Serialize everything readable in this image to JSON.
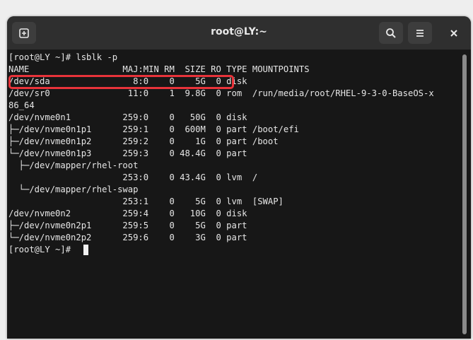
{
  "window": {
    "title": "root@LY:~"
  },
  "icons": {
    "new_tab": "new-tab-icon",
    "search": "search-icon",
    "menu": "hamburger-menu-icon",
    "close": "close-icon"
  },
  "colors": {
    "terminal_bg": "#171717",
    "titlebar_bg": "#2f2f2f",
    "text": "#e6e6e6",
    "highlight": "#e8333a"
  },
  "terminal": {
    "lines": [
      "[root@LY ~]# lsblk -p",
      "NAME                  MAJ:MIN RM  SIZE RO TYPE MOUNTPOINTS",
      "/dev/sda                8:0    0    5G  0 disk",
      "/dev/sr0               11:0    1  9.8G  0 rom  /run/media/root/RHEL-9-3-0-BaseOS-x",
      "86_64",
      "/dev/nvme0n1          259:0    0   50G  0 disk",
      "├─/dev/nvme0n1p1      259:1    0  600M  0 part /boot/efi",
      "├─/dev/nvme0n1p2      259:2    0    1G  0 part /boot",
      "└─/dev/nvme0n1p3      259:3    0 48.4G  0 part",
      "  ├─/dev/mapper/rhel-root",
      "                      253:0    0 43.4G  0 lvm  /",
      "  └─/dev/mapper/rhel-swap",
      "                      253:1    0    5G  0 lvm  [SWAP]",
      "/dev/nvme0n2          259:4    0   10G  0 disk",
      "├─/dev/nvme0n2p1      259:5    0    5G  0 part",
      "└─/dev/nvme0n2p2      259:6    0    3G  0 part",
      "[root@LY ~]# "
    ]
  }
}
